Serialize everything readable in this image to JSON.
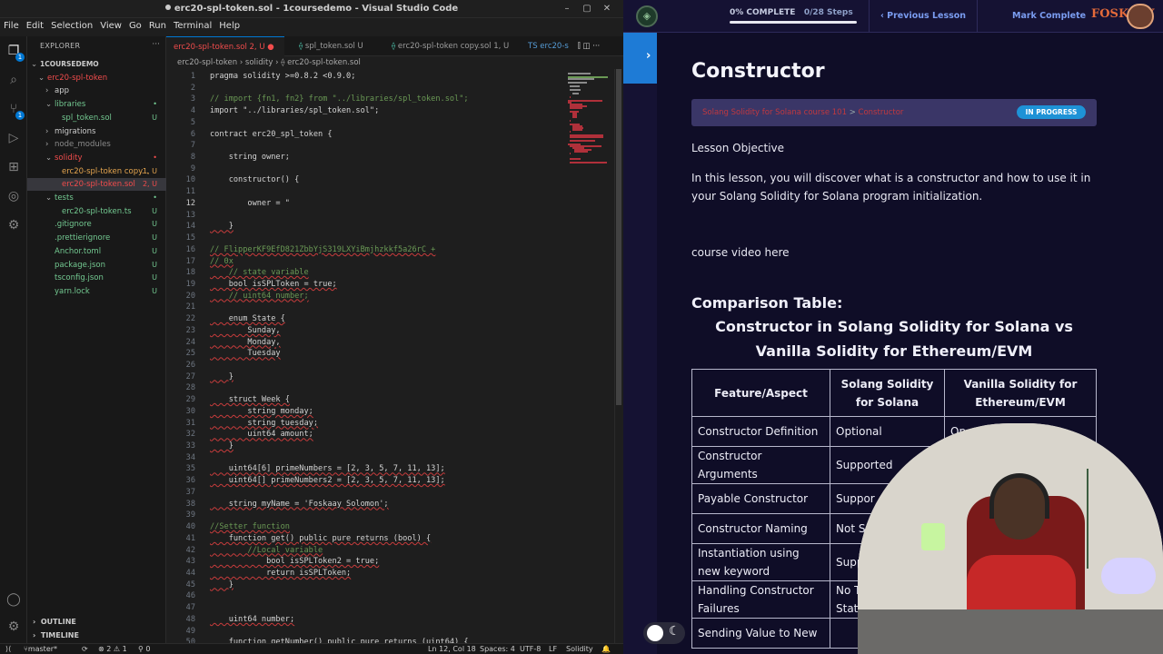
{
  "window": {
    "title": "erc20-spl-token.sol - 1coursedemo - Visual Studio Code",
    "controls": [
      "–",
      "▢",
      "✕"
    ]
  },
  "menu": [
    "File",
    "Edit",
    "Selection",
    "View",
    "Go",
    "Run",
    "Terminal",
    "Help"
  ],
  "activity_badges": {
    "explorer": "1",
    "scm": "1"
  },
  "sidebar": {
    "header": "EXPLORER",
    "more": "···",
    "items": [
      {
        "label": "1COURSEDEMO",
        "indent": 0,
        "chev": "⌄",
        "color": "#cccccc",
        "status": ""
      },
      {
        "label": "erc20-spl-token",
        "indent": 1,
        "chev": "⌄",
        "color": "#f14c4c",
        "status": ""
      },
      {
        "label": "app",
        "indent": 2,
        "chev": "›",
        "color": "#cccccc",
        "status": ""
      },
      {
        "label": "libraries",
        "indent": 2,
        "chev": "⌄",
        "color": "#73c991",
        "status": "•"
      },
      {
        "label": "spl_token.sol",
        "indent": 3,
        "chev": "",
        "color": "#73c991",
        "status": "U"
      },
      {
        "label": "migrations",
        "indent": 2,
        "chev": "›",
        "color": "#cccccc",
        "status": ""
      },
      {
        "label": "node_modules",
        "indent": 2,
        "chev": "›",
        "color": "#8b8b8b",
        "status": ""
      },
      {
        "label": "solidity",
        "indent": 2,
        "chev": "⌄",
        "color": "#f14c4c",
        "status": "•"
      },
      {
        "label": "erc20-spl-token copy...",
        "indent": 3,
        "chev": "",
        "color": "#e5a54f",
        "status": "1, U"
      },
      {
        "label": "erc20-spl-token.sol",
        "indent": 3,
        "chev": "",
        "color": "#f14c4c",
        "status": "2, U"
      },
      {
        "label": "tests",
        "indent": 2,
        "chev": "⌄",
        "color": "#73c991",
        "status": "•"
      },
      {
        "label": "erc20-spl-token.ts",
        "indent": 3,
        "chev": "",
        "color": "#73c991",
        "status": "U"
      },
      {
        "label": ".gitignore",
        "indent": 2,
        "chev": "",
        "color": "#73c991",
        "status": "U"
      },
      {
        "label": ".prettierignore",
        "indent": 2,
        "chev": "",
        "color": "#73c991",
        "status": "U"
      },
      {
        "label": "Anchor.toml",
        "indent": 2,
        "chev": "",
        "color": "#73c991",
        "status": "U"
      },
      {
        "label": "package.json",
        "indent": 2,
        "chev": "",
        "color": "#73c991",
        "status": "U"
      },
      {
        "label": "tsconfig.json",
        "indent": 2,
        "chev": "",
        "color": "#73c991",
        "status": "U"
      },
      {
        "label": "yarn.lock",
        "indent": 2,
        "chev": "",
        "color": "#73c991",
        "status": "U"
      }
    ],
    "outline": "OUTLINE",
    "timeline": "TIMELINE"
  },
  "tabs": [
    {
      "label": "erc20-spl-token.sol 2, U ●",
      "active": true
    },
    {
      "label": "spl_token.sol U",
      "active": false
    },
    {
      "label": "erc20-spl-token copy.sol 1, U",
      "active": false
    },
    {
      "label": "TS erc20-s",
      "active": false
    }
  ],
  "breadcrumb": "erc20-spl-token  ›  solidity  ›  ⟠ erc20-spl-token.sol",
  "code": [
    {
      "n": "1",
      "t": "pragma solidity >=0.8.2 <0.9.0;",
      "c": ""
    },
    {
      "n": "2",
      "t": "",
      "c": ""
    },
    {
      "n": "3",
      "t": "// import {fn1, fn2} from \"../libraries/spl_token.sol\";",
      "c": "cm"
    },
    {
      "n": "4",
      "t": "import \"../libraries/spl_token.sol\";",
      "c": ""
    },
    {
      "n": "5",
      "t": "",
      "c": ""
    },
    {
      "n": "6",
      "t": "contract erc20_spl_token {",
      "c": ""
    },
    {
      "n": "7",
      "t": "",
      "c": ""
    },
    {
      "n": "8",
      "t": "    string owner;",
      "c": ""
    },
    {
      "n": "9",
      "t": "",
      "c": ""
    },
    {
      "n": "10",
      "t": "    constructor() {",
      "c": ""
    },
    {
      "n": "11",
      "t": "",
      "c": ""
    },
    {
      "n": "12",
      "t": "        owner = \"",
      "c": ""
    },
    {
      "n": "13",
      "t": "",
      "c": ""
    },
    {
      "n": "14",
      "t": "    }",
      "c": ""
    },
    {
      "n": "15",
      "t": "",
      "c": ""
    },
    {
      "n": "16",
      "t": "// FlipperKF9EfD821ZbbYjS319LXYiBmjhzkkf5a26rC +",
      "c": "cm"
    },
    {
      "n": "17",
      "t": "// 0x",
      "c": "cm"
    },
    {
      "n": "18",
      "t": "    // state variable",
      "c": "cm"
    },
    {
      "n": "19",
      "t": "    bool isSPLToken = true;",
      "c": ""
    },
    {
      "n": "20",
      "t": "    // uint64 number;",
      "c": "cm"
    },
    {
      "n": "21",
      "t": "",
      "c": ""
    },
    {
      "n": "22",
      "t": "    enum State {",
      "c": ""
    },
    {
      "n": "23",
      "t": "        Sunday,",
      "c": ""
    },
    {
      "n": "24",
      "t": "        Monday,",
      "c": ""
    },
    {
      "n": "25",
      "t": "        Tuesday",
      "c": ""
    },
    {
      "n": "26",
      "t": "",
      "c": ""
    },
    {
      "n": "27",
      "t": "    }",
      "c": ""
    },
    {
      "n": "28",
      "t": "",
      "c": ""
    },
    {
      "n": "29",
      "t": "    struct Week {",
      "c": ""
    },
    {
      "n": "30",
      "t": "        string monday;",
      "c": ""
    },
    {
      "n": "31",
      "t": "        string tuesday;",
      "c": ""
    },
    {
      "n": "32",
      "t": "        uint64 amount;",
      "c": ""
    },
    {
      "n": "33",
      "t": "    }",
      "c": ""
    },
    {
      "n": "34",
      "t": "",
      "c": ""
    },
    {
      "n": "35",
      "t": "    uint64[6] primeNumbers = [2, 3, 5, 7, 11, 13];",
      "c": ""
    },
    {
      "n": "36",
      "t": "    uint64[] primeNumbers2 = [2, 3, 5, 7, 11, 13];",
      "c": ""
    },
    {
      "n": "37",
      "t": "",
      "c": ""
    },
    {
      "n": "38",
      "t": "    string myName = 'Foskaay Solomon';",
      "c": ""
    },
    {
      "n": "39",
      "t": "",
      "c": ""
    },
    {
      "n": "40",
      "t": "//Setter function",
      "c": "cm"
    },
    {
      "n": "41",
      "t": "    function get() public pure returns (bool) {",
      "c": ""
    },
    {
      "n": "42",
      "t": "        //Local variable",
      "c": "cm"
    },
    {
      "n": "43",
      "t": "            bool isSPLToken2 = true;",
      "c": ""
    },
    {
      "n": "44",
      "t": "            return isSPLToken;",
      "c": ""
    },
    {
      "n": "45",
      "t": "    }",
      "c": ""
    },
    {
      "n": "46",
      "t": "",
      "c": ""
    },
    {
      "n": "47",
      "t": "",
      "c": ""
    },
    {
      "n": "48",
      "t": "    uint64 number;",
      "c": ""
    },
    {
      "n": "49",
      "t": "",
      "c": ""
    },
    {
      "n": "50",
      "t": "    function getNumber() public pure returns (uint64) {",
      "c": ""
    }
  ],
  "statusbar": {
    "branch": "master*",
    "sync": "⟳",
    "problems": "⊗ 2 ⚠ 1",
    "ports": "⚲ 0",
    "position": "Ln 12, Col 18",
    "spaces": "Spaces: 4",
    "encoding": "UTF-8",
    "eol": "LF",
    "language": "Solidity",
    "bell": "🔔"
  },
  "lms": {
    "progress": "0% COMPLETE",
    "steps": "0/28 Steps",
    "prev": "‹  Previous Lesson",
    "mark": "Mark Complete",
    "brand": "FOSKAAY",
    "title": "Constructor",
    "crumb_course": "Solang Solidity for Solana course 101",
    "crumb_sep": " > ",
    "crumb_lesson": "Constructor",
    "status": "IN PROGRESS",
    "objective_label": "Lesson Objective",
    "objective": "In this lesson, you will discover what is a constructor and how to use it in your Solang Solidity for Solana program initialization.",
    "video": "course video here",
    "comparison_h1": "Comparison Table:",
    "comparison_h2": "Constructor in Solang Solidity for Solana vs Vanilla Solidity for Ethereum/EVM",
    "table_headers": [
      "Feature/Aspect",
      "Solang Solidity for Solana",
      "Vanilla Solidity for Ethereum/EVM"
    ],
    "table_rows": [
      [
        "Constructor Definition",
        "Optional",
        "Op"
      ],
      [
        "Constructor Arguments",
        "Supported",
        ""
      ],
      [
        "Payable Constructor",
        "Suppor",
        ""
      ],
      [
        "Constructor Naming",
        "Not S",
        ""
      ],
      [
        "Instantiation using new keyword",
        "Supp",
        ""
      ],
      [
        "Handling Constructor Failures",
        "No Try-Ca Statement",
        ""
      ],
      [
        "Sending Value to New",
        "",
        ""
      ]
    ]
  }
}
